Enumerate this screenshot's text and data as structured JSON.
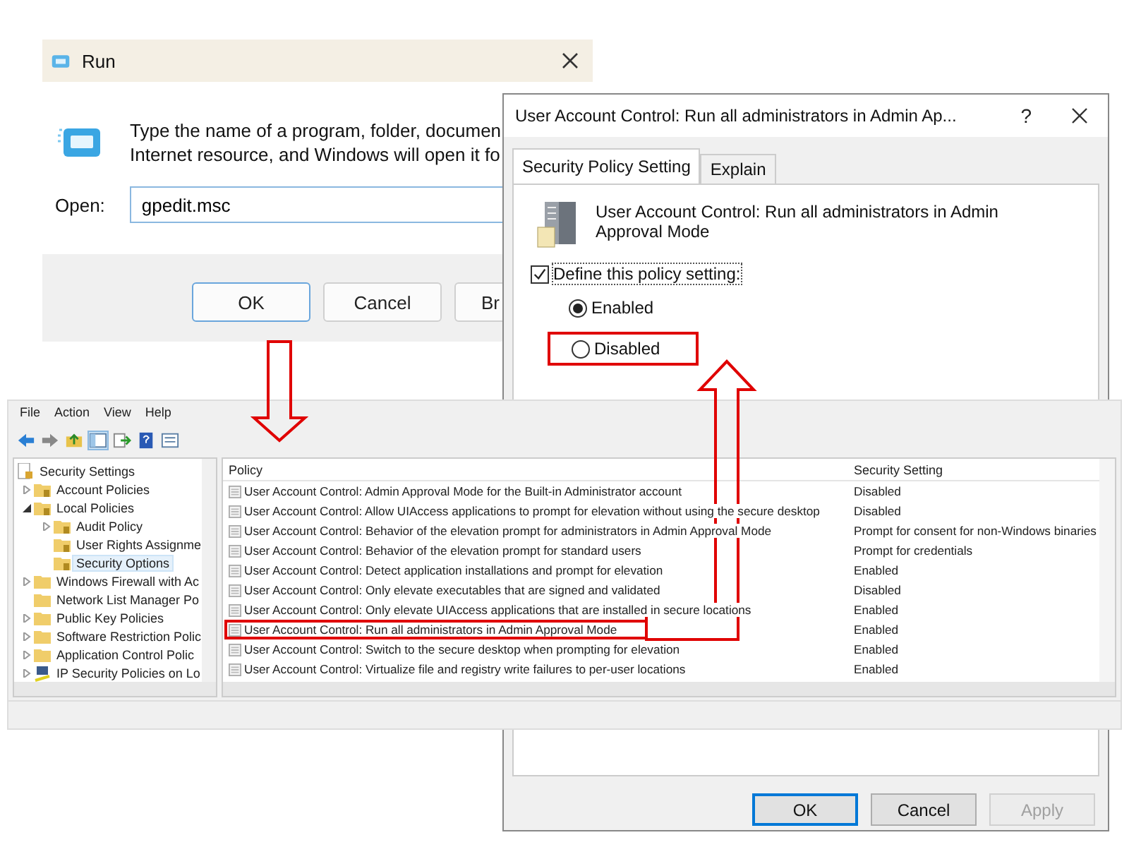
{
  "run_dialog": {
    "title": "Run",
    "description_lines": [
      "Type the name of a program, folder, documen",
      "Internet resource, and Windows will open it fo"
    ],
    "open_label": "Open:",
    "open_value": "gpedit.msc",
    "buttons": [
      {
        "label": "OK",
        "default": true
      },
      {
        "label": "Cancel",
        "default": false
      },
      {
        "label": "Br",
        "default": false
      }
    ]
  },
  "policy_dialog": {
    "title": "User Account Control: Run all administrators in Admin Ap...",
    "help": "?",
    "tabs": [
      {
        "label": "Security Policy Setting",
        "selected": true
      },
      {
        "label": "Explain",
        "selected": false
      }
    ],
    "policy_name": "User Account Control: Run all administrators in Admin Approval Mode",
    "define_checkbox": {
      "label": "Define this policy setting:",
      "checked": true
    },
    "options": [
      {
        "label": "Enabled",
        "selected": true,
        "highlighted": false
      },
      {
        "label": "Disabled",
        "selected": false,
        "highlighted": true
      }
    ],
    "buttons": [
      {
        "label": "OK",
        "default": true,
        "disabled": false
      },
      {
        "label": "Cancel",
        "default": false,
        "disabled": false
      },
      {
        "label": "Apply",
        "default": false,
        "disabled": true
      }
    ]
  },
  "editor": {
    "menu": [
      "File",
      "Action",
      "View",
      "Help"
    ],
    "tree": [
      {
        "label": "Security Settings",
        "kind": "root",
        "selected": false,
        "children": [
          {
            "label": "Account Policies",
            "kind": "folder",
            "expanded": false,
            "selected": false
          },
          {
            "label": "Local Policies",
            "kind": "folder",
            "expanded": true,
            "selected": false,
            "children": [
              {
                "label": "Audit Policy",
                "kind": "folder",
                "expanded": false,
                "selected": false
              },
              {
                "label": "User Rights Assignme",
                "kind": "folder",
                "selected": false
              },
              {
                "label": "Security Options",
                "kind": "folder",
                "selected": true
              }
            ]
          },
          {
            "label": "Windows Firewall with Ac",
            "kind": "plain",
            "expanded": false,
            "selected": false
          },
          {
            "label": "Network List Manager Po",
            "kind": "plain",
            "selected": false
          },
          {
            "label": "Public Key Policies",
            "kind": "plain",
            "expanded": false,
            "selected": false
          },
          {
            "label": "Software Restriction Polic",
            "kind": "plain",
            "expanded": false,
            "selected": false
          },
          {
            "label": "Application Control Polic",
            "kind": "plain",
            "expanded": false,
            "selected": false
          },
          {
            "label": "IP Security Policies on Lo",
            "kind": "network",
            "expanded": false,
            "selected": false
          }
        ]
      }
    ],
    "table": {
      "columns": [
        "Policy",
        "Security Setting"
      ],
      "rows": [
        {
          "policy": "User Account Control: Admin Approval Mode for the Built-in Administrator account",
          "setting": "Disabled",
          "highlighted": false
        },
        {
          "policy": "User Account Control: Allow UIAccess applications to prompt for elevation without using the secure desktop",
          "setting": "Disabled",
          "highlighted": false
        },
        {
          "policy": "User Account Control: Behavior of the elevation prompt for administrators in Admin Approval Mode",
          "setting": "Prompt for consent for non-Windows binaries",
          "highlighted": false
        },
        {
          "policy": "User Account Control: Behavior of the elevation prompt for standard users",
          "setting": "Prompt for credentials",
          "highlighted": false
        },
        {
          "policy": "User Account Control: Detect application installations and prompt for elevation",
          "setting": "Enabled",
          "highlighted": false
        },
        {
          "policy": "User Account Control: Only elevate executables that are signed and validated",
          "setting": "Disabled",
          "highlighted": false
        },
        {
          "policy": "User Account Control: Only elevate UIAccess applications that are installed in secure locations",
          "setting": "Enabled",
          "highlighted": false
        },
        {
          "policy": "User Account Control: Run all administrators in Admin Approval Mode",
          "setting": "Enabled",
          "highlighted": true
        },
        {
          "policy": "User Account Control: Switch to the secure desktop when prompting for elevation",
          "setting": "Enabled",
          "highlighted": false
        },
        {
          "policy": "User Account Control: Virtualize file and registry write failures to per-user locations",
          "setting": "Enabled",
          "highlighted": false
        }
      ]
    }
  }
}
